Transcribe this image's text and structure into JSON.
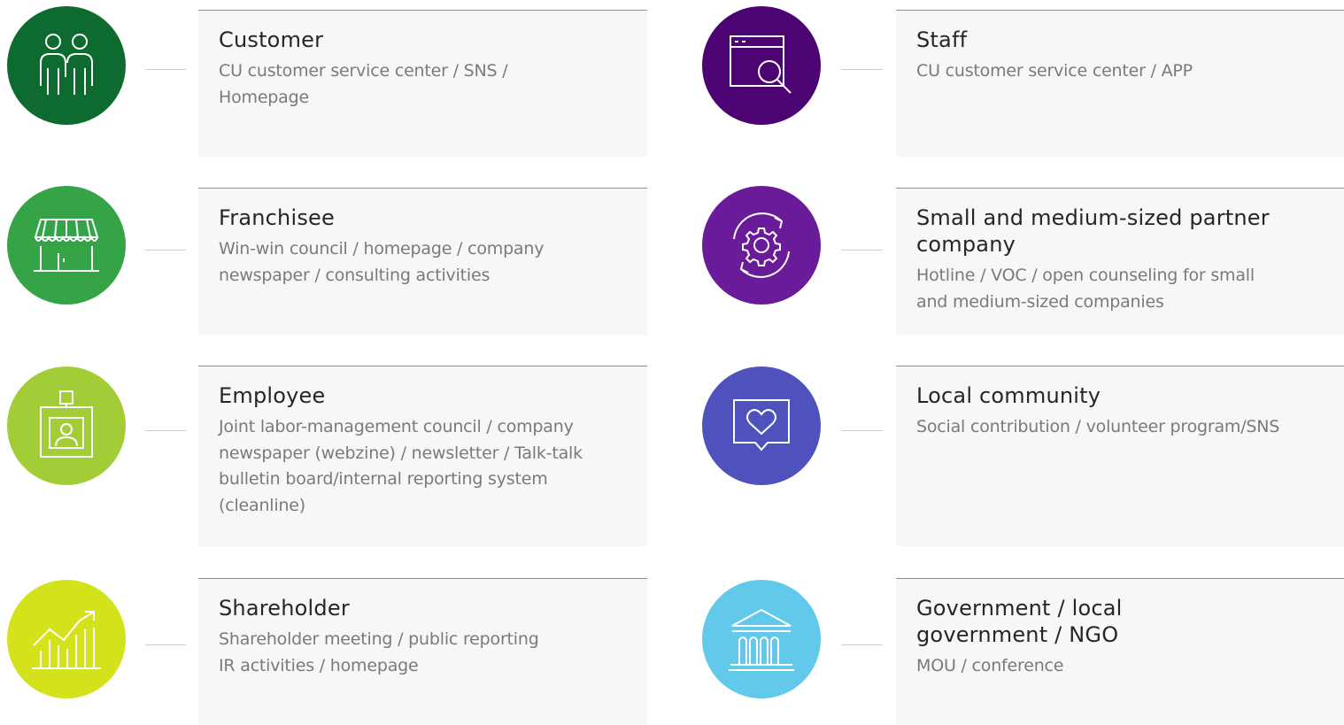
{
  "stakeholders": [
    {
      "title": "Customer",
      "description": "CU customer service center / SNS / Homepage",
      "icon": "people-icon",
      "color": "#0e6b2f"
    },
    {
      "title": "Staff",
      "description": "CU customer service center / APP",
      "icon": "browser-search-icon",
      "color": "#4d0473"
    },
    {
      "title": "Franchisee",
      "description": "Win-win council / homepage / company newspaper / consulting activities",
      "icon": "storefront-icon",
      "color": "#35a447"
    },
    {
      "title": "Small and medium-sized partner company",
      "description": "Hotline / VOC / open counseling for small and medium-sized companies",
      "icon": "gear-cycle-icon",
      "color": "#6a1b9a"
    },
    {
      "title": "Employee",
      "description": "Joint labor-management council / company newspaper (webzine) / newsletter / Talk-talk bulletin board/internal reporting system (cleanline)",
      "icon": "id-badge-icon",
      "color": "#a2cd36"
    },
    {
      "title": "Local community",
      "description": "Social contribution / volunteer program/SNS",
      "icon": "heart-speech-bubble-icon",
      "color": "#4f52bd"
    },
    {
      "title": "Shareholder",
      "description": "Shareholder meeting / public reporting IR activities / homepage",
      "icon": "growth-chart-icon",
      "color": "#d4e21c"
    },
    {
      "title": "Government / local government / NGO",
      "description": "MOU / conference",
      "icon": "government-building-icon",
      "color": "#62c9ea"
    }
  ]
}
